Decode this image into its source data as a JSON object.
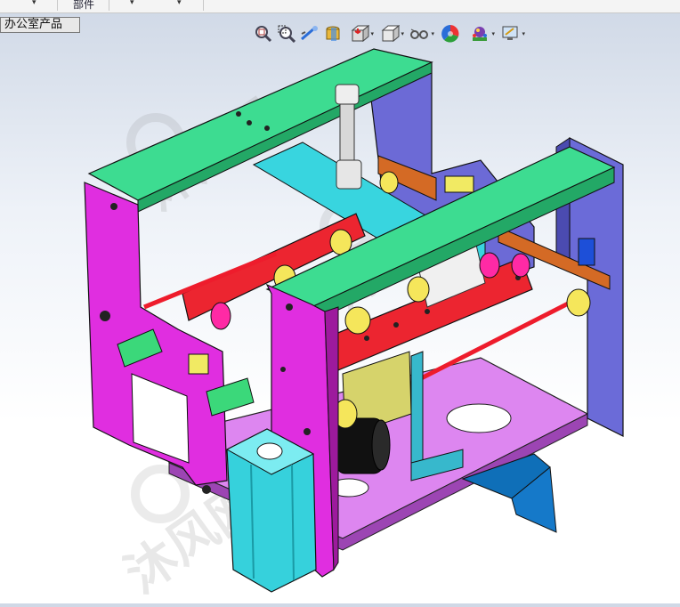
{
  "menubar": {
    "part_label": "部件"
  },
  "tab": {
    "label": "办公室产品"
  },
  "toolbar": {
    "icons": [
      "zoom-to-fit-icon",
      "zoom-to-area-icon",
      "previous-view-icon",
      "section-view-icon",
      "view-orientation-icon",
      "display-style-icon",
      "hide-show-items-icon",
      "edit-appearance-icon",
      "apply-scene-icon",
      "view-settings-icon"
    ]
  },
  "watermark": {
    "text": "沐风网"
  },
  "colors": {
    "magenta": "#e02ee0",
    "green": "#3ddc91",
    "purple": "#6b6bd8",
    "cyan": "#39d6e0",
    "red": "#ee1c2c",
    "orange": "#d2691e",
    "lavender": "#d67ef0",
    "black": "#111111",
    "yellow": "#e8e060",
    "pink": "#ff2aa5"
  }
}
